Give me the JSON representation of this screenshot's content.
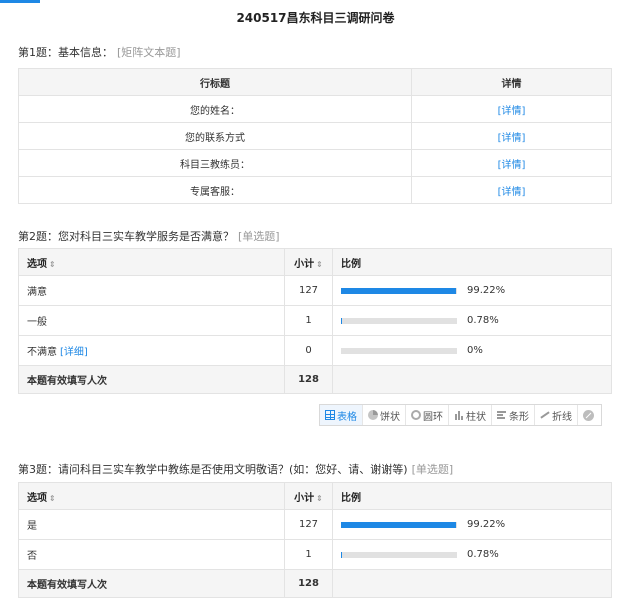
{
  "survey_title": "240517昌东科目三调研问卷",
  "q1": {
    "heading": "第1题：基本信息：",
    "type": "矩阵文本题",
    "col_label": "行标题",
    "col_detail": "详情",
    "rows": [
      {
        "label": "您的姓名：",
        "detail": "详情"
      },
      {
        "label": "您的联系方式",
        "detail": "详情"
      },
      {
        "label": "科目三教练员：",
        "detail": "详情"
      },
      {
        "label": "专属客服：",
        "detail": "详情"
      }
    ]
  },
  "q2": {
    "heading": "第2题：您对科目三实车教学服务是否满意？",
    "type": "单选题",
    "col_option": "选项",
    "col_count": "小计",
    "col_ratio": "比例",
    "sort_icon": "sort-arrows-icon",
    "rows": [
      {
        "option": "满意",
        "count": "127",
        "pct": "99.22%",
        "fraction": 0.9922
      },
      {
        "option": "一般",
        "count": "1",
        "pct": "0.78%",
        "fraction": 0.0078
      },
      {
        "option": "不满意",
        "detail": "详细",
        "count": "0",
        "pct": "0%",
        "fraction": 0
      }
    ],
    "total_label": "本题有效填写人次",
    "total": "128"
  },
  "toolbar": {
    "items": [
      {
        "label": "表格",
        "icon": "table-icon",
        "active": true
      },
      {
        "label": "饼状",
        "icon": "pie-chart-icon"
      },
      {
        "label": "圆环",
        "icon": "ring-chart-icon"
      },
      {
        "label": "柱状",
        "icon": "column-chart-icon"
      },
      {
        "label": "条形",
        "icon": "bar-chart-icon"
      },
      {
        "label": "折线",
        "icon": "line-chart-icon"
      },
      {
        "icon": "disable-icon"
      }
    ]
  },
  "q3": {
    "heading": "第3题：请问科目三实车教学中教练是否使用文明敬语？(如：您好、请、谢谢等)",
    "type": "单选题",
    "col_option": "选项",
    "col_count": "小计",
    "col_ratio": "比例",
    "rows": [
      {
        "option": "是",
        "count": "127",
        "pct": "99.22%",
        "fraction": 0.9922
      },
      {
        "option": "否",
        "count": "1",
        "pct": "0.78%",
        "fraction": 0.0078
      }
    ],
    "total_label": "本题有效填写人次",
    "total": "128"
  },
  "colors": {
    "accent": "#1e88e5",
    "bar_track": "#e1e1e1",
    "header_bg": "#f5f5f5"
  }
}
